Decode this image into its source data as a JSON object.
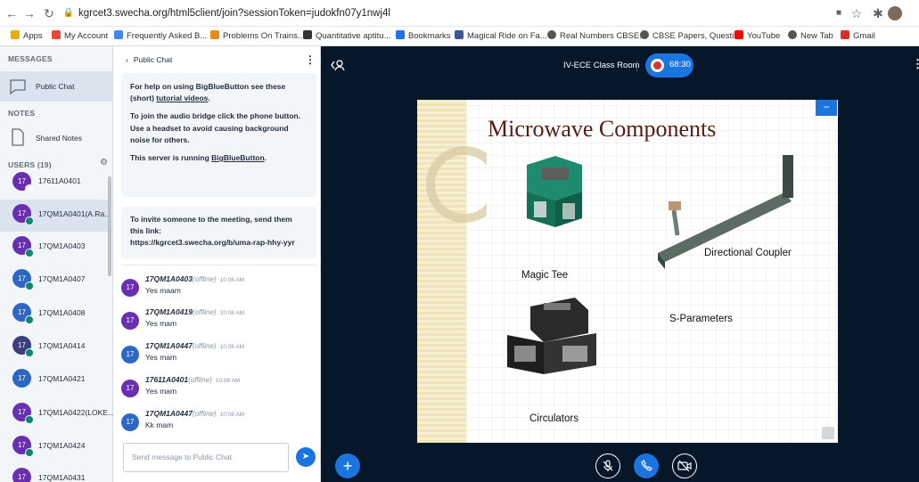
{
  "browser": {
    "url": "kgrcet3.swecha.org/html5client/join?sessionToken=judokfn07y1nwj4l",
    "bookmarks": [
      {
        "label": "Apps",
        "color": "#e8ad14"
      },
      {
        "label": "My Account",
        "color": "#e8493b"
      },
      {
        "label": "Frequently Asked B...",
        "color": "#4285f4"
      },
      {
        "label": "Problems On Trains...",
        "color": "#e88a1a"
      },
      {
        "label": "Quantitative aptitu...",
        "color": "#333333"
      },
      {
        "label": "Bookmarks",
        "color": "#1a73e8"
      },
      {
        "label": "Magical Ride on Fa...",
        "color": "#3b5998"
      },
      {
        "label": "Real Numbers CBSE...",
        "color": "#555555"
      },
      {
        "label": "CBSE Papers, Questi...",
        "color": "#555555"
      },
      {
        "label": "YouTube",
        "color": "#ff0000"
      },
      {
        "label": "New Tab",
        "color": "#555555"
      },
      {
        "label": "Gmail",
        "color": "#d93025"
      }
    ]
  },
  "sidebar": {
    "messages_header": "MESSAGES",
    "public_chat": "Public Chat",
    "notes_header": "NOTES",
    "shared_notes": "Shared Notes",
    "users_header": "USERS (19)",
    "users": [
      {
        "avatar": "17",
        "name": "17611A0401"
      },
      {
        "avatar": "17",
        "name": "17QM1A0401(A.Ra..."
      },
      {
        "avatar": "17",
        "name": "17QM1A0403"
      },
      {
        "avatar": "17",
        "name": "17QM1A0407"
      },
      {
        "avatar": "17",
        "name": "17QM1A0408"
      },
      {
        "avatar": "17",
        "name": "17QM1A0414"
      },
      {
        "avatar": "17",
        "name": "17QM1A0421"
      },
      {
        "avatar": "17",
        "name": "17QM1A0422(LOKE..."
      },
      {
        "avatar": "17",
        "name": "17QM1A0424"
      },
      {
        "avatar": "17",
        "name": "17QM1A0431"
      }
    ]
  },
  "chat": {
    "title": "Public Chat",
    "welcome": {
      "line1a": "For help on using BigBlueButton see these (short) ",
      "line1_link": "tutorial videos",
      "line1b": ".",
      "line2": "To join the audio bridge click the phone button. Use a headset to avoid causing background noise for others.",
      "line3a": "This server is running ",
      "line3_link": "BigBlueButton",
      "line3b": "."
    },
    "invite": {
      "text": "To invite someone to the meeting, send them this link:",
      "link": "https://kgrcet3.swecha.org/b/uma-rap-hhy-yyr"
    },
    "messages": [
      {
        "avatar": "17",
        "name": "17QM1A0403",
        "status": "(offline)",
        "time": "10:08 AM",
        "text": "Yes maam"
      },
      {
        "avatar": "17",
        "name": "17QM1A0419",
        "status": "(offline)",
        "time": "10:08 AM",
        "text": "Yes mam"
      },
      {
        "avatar": "17",
        "name": "17QM1A0447",
        "status": "(offline)",
        "time": "10:08 AM",
        "text": "Yes mam"
      },
      {
        "avatar": "17",
        "name": "17611A0401",
        "status": "(offline)",
        "time": "10:08 AM",
        "text": "Yes mam"
      },
      {
        "avatar": "17",
        "name": "17QM1A0447",
        "status": "(offline)",
        "time": "10:08 AM",
        "text": "Kk mam"
      }
    ],
    "input_placeholder": "Send message to Public Chat"
  },
  "main": {
    "room_title": "IV-ECE Class Room",
    "recording_time": "68:30",
    "slide": {
      "title": "Microwave Components",
      "labels": {
        "magic_tee": "Magic Tee",
        "directional_coupler": "Directional Coupler",
        "s_parameters": "S-Parameters",
        "circulators": "Circulators"
      }
    }
  },
  "colors": {
    "accent": "#1b75e1",
    "recording": "#e02d2d",
    "background": "#06172a"
  }
}
